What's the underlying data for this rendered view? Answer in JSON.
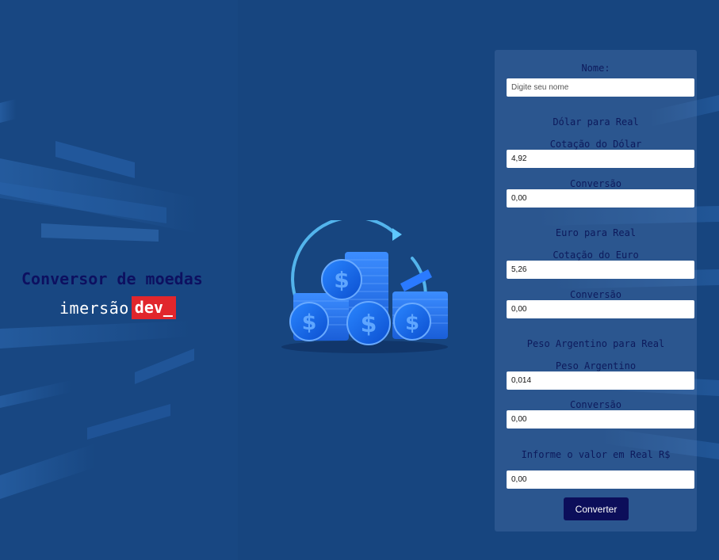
{
  "brand": {
    "title": "Conversor de moedas",
    "logo_word": "imersão",
    "logo_tag": "dev_"
  },
  "form": {
    "name_label": "Nome:",
    "name_placeholder": "Digite seu nome",
    "name_value": "",
    "dollar": {
      "section_title": "Dólar para Real",
      "rate_label": "Cotação do Dólar",
      "rate_value": "4,92",
      "conversion_label": "Conversão",
      "conversion_value": "0,00"
    },
    "euro": {
      "section_title": "Euro para Real",
      "rate_label": "Cotação do Euro",
      "rate_value": "5,26",
      "conversion_label": "Conversão",
      "conversion_value": "0,00"
    },
    "peso": {
      "section_title": "Peso Argentino para Real",
      "rate_label": "Peso Argentino",
      "rate_value": "0,014",
      "conversion_label": "Conversão",
      "conversion_value": "0,00"
    },
    "amount_label": "Informe o valor em Real R$",
    "amount_value": "0,00",
    "convert_button": "Converter"
  },
  "illustration": {
    "icon": "coin-stack-dollar-icon",
    "coin_symbol": "$"
  },
  "colors": {
    "background": "#17457f",
    "title": "#0d1060",
    "brand_tag": "#e1262c",
    "button": "#0c0e5a",
    "coin": "#1f6df0"
  }
}
